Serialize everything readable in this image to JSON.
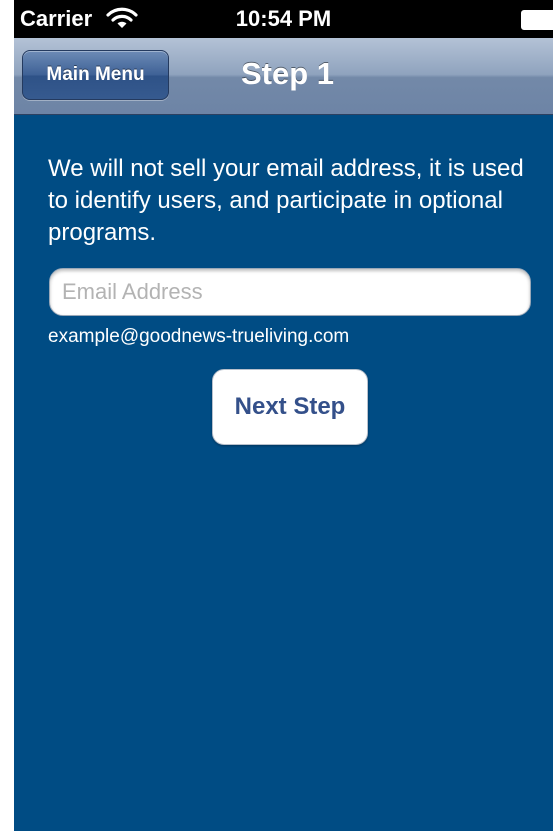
{
  "status_bar": {
    "carrier": "Carrier",
    "time": "10:54 PM",
    "wifi_icon": "wifi-icon",
    "battery_icon": "battery-icon"
  },
  "nav": {
    "back_label": "Main Menu",
    "title": "Step 1"
  },
  "form": {
    "intro_text": "We will not sell your email address, it is used to identify users, and participate in optional programs.",
    "email_placeholder": "Email Address",
    "email_value": "",
    "example_text": "example@goodnews-trueliving.com",
    "next_label": "Next Step"
  },
  "colors": {
    "content_background": "#004c84",
    "button_text": "#34508a",
    "nav_gradient_top": "#b4c2d6",
    "nav_gradient_bottom": "#6d84a6"
  }
}
